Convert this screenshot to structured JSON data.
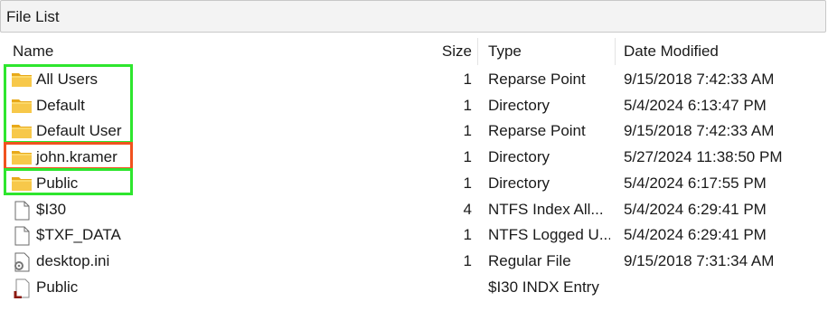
{
  "panel_title": "File List",
  "columns": {
    "name": "Name",
    "size": "Size",
    "type": "Type",
    "date": "Date Modified"
  },
  "rows": [
    {
      "name": "All Users",
      "size": "1",
      "type": "Reparse Point",
      "date": "9/15/2018 7:42:33 AM",
      "icon": "folder-icon",
      "highlight": "green"
    },
    {
      "name": "Default",
      "size": "1",
      "type": "Directory",
      "date": "5/4/2024 6:13:47 PM",
      "icon": "folder-icon",
      "highlight": "green"
    },
    {
      "name": "Default User",
      "size": "1",
      "type": "Reparse Point",
      "date": "9/15/2018 7:42:33 AM",
      "icon": "folder-icon",
      "highlight": "green"
    },
    {
      "name": "john.kramer",
      "size": "1",
      "type": "Directory",
      "date": "5/27/2024 11:38:50 PM",
      "icon": "folder-icon",
      "highlight": "red"
    },
    {
      "name": "Public",
      "size": "1",
      "type": "Directory",
      "date": "5/4/2024 6:17:55 PM",
      "icon": "folder-icon",
      "highlight": "green"
    },
    {
      "name": "$I30",
      "size": "4",
      "type": "NTFS Index All...",
      "date": "5/4/2024 6:29:41 PM",
      "icon": "file-icon"
    },
    {
      "name": "$TXF_DATA",
      "size": "1",
      "type": "NTFS Logged U...",
      "date": "5/4/2024 6:29:41 PM",
      "icon": "file-icon"
    },
    {
      "name": "desktop.ini",
      "size": "1",
      "type": "Regular File",
      "date": "9/15/2018 7:31:34 AM",
      "icon": "settings-file-icon"
    },
    {
      "name": "Public",
      "size": "",
      "type": "$I30 INDX Entry",
      "date": "",
      "icon": "index-entry-icon"
    }
  ],
  "colors": {
    "highlight_green": "#2ee62e",
    "highlight_red": "#f0521e",
    "folder": "#f4c233"
  }
}
